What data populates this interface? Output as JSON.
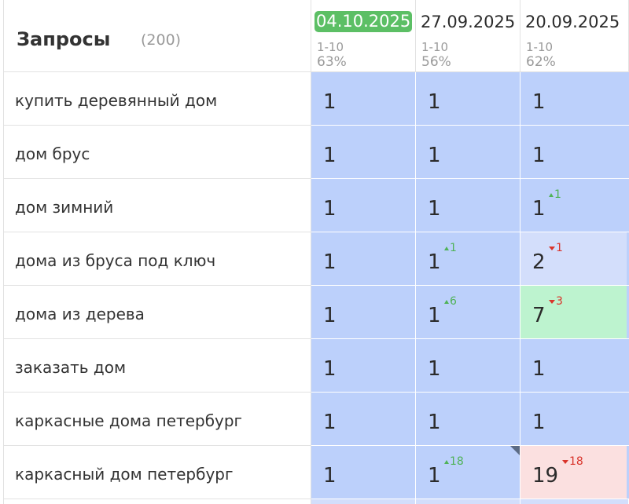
{
  "header": {
    "title": "Запросы",
    "count": "(200)",
    "dates": [
      {
        "date": "04.10.2025",
        "active": true,
        "range": "1-10",
        "pct": "63%"
      },
      {
        "date": "27.09.2025",
        "active": false,
        "range": "1-10",
        "pct": "56%"
      },
      {
        "date": "20.09.2025",
        "active": false,
        "range": "1-10",
        "pct": "62%"
      }
    ]
  },
  "rows": [
    {
      "query": "купить деревянный дом",
      "cells": [
        {
          "value": "1",
          "delta": "",
          "dir": "",
          "style": "blue"
        },
        {
          "value": "1",
          "delta": "",
          "dir": "",
          "style": "blue"
        },
        {
          "value": "1",
          "delta": "",
          "dir": "",
          "style": "blue"
        }
      ]
    },
    {
      "query": "дом брус",
      "cells": [
        {
          "value": "1",
          "delta": "",
          "dir": "",
          "style": "blue"
        },
        {
          "value": "1",
          "delta": "",
          "dir": "",
          "style": "blue"
        },
        {
          "value": "1",
          "delta": "",
          "dir": "",
          "style": "blue"
        }
      ]
    },
    {
      "query": "дом зимний",
      "cells": [
        {
          "value": "1",
          "delta": "",
          "dir": "",
          "style": "blue"
        },
        {
          "value": "1",
          "delta": "",
          "dir": "",
          "style": "blue"
        },
        {
          "value": "1",
          "delta": "1",
          "dir": "up",
          "style": "blue"
        }
      ]
    },
    {
      "query": "дома из бруса под ключ",
      "cells": [
        {
          "value": "1",
          "delta": "",
          "dir": "",
          "style": "blue"
        },
        {
          "value": "1",
          "delta": "1",
          "dir": "up",
          "style": "blue"
        },
        {
          "value": "2",
          "delta": "1",
          "dir": "down",
          "style": "light"
        }
      ]
    },
    {
      "query": "дома из дерева",
      "cells": [
        {
          "value": "1",
          "delta": "",
          "dir": "",
          "style": "blue"
        },
        {
          "value": "1",
          "delta": "6",
          "dir": "up",
          "style": "blue"
        },
        {
          "value": "7",
          "delta": "3",
          "dir": "down",
          "style": "green"
        }
      ]
    },
    {
      "query": "заказать дом",
      "cells": [
        {
          "value": "1",
          "delta": "",
          "dir": "",
          "style": "blue"
        },
        {
          "value": "1",
          "delta": "",
          "dir": "",
          "style": "blue"
        },
        {
          "value": "1",
          "delta": "",
          "dir": "",
          "style": "blue"
        }
      ]
    },
    {
      "query": "каркасные дома петербург",
      "cells": [
        {
          "value": "1",
          "delta": "",
          "dir": "",
          "style": "blue"
        },
        {
          "value": "1",
          "delta": "",
          "dir": "",
          "style": "blue"
        },
        {
          "value": "1",
          "delta": "",
          "dir": "",
          "style": "blue"
        }
      ]
    },
    {
      "query": "каркасный дом петербург",
      "cells": [
        {
          "value": "1",
          "delta": "",
          "dir": "",
          "style": "blue"
        },
        {
          "value": "1",
          "delta": "18",
          "dir": "up",
          "style": "blue",
          "marker": true
        },
        {
          "value": "19",
          "delta": "18",
          "dir": "down",
          "style": "pink"
        }
      ]
    }
  ],
  "colors": {
    "active_date_bg": "#5cbf65",
    "top_position": "#bcd0fb",
    "light_position": "#d3defb",
    "green_position": "#bdf3cf",
    "pink_position": "#fbe0e0",
    "up": "#4fb257",
    "down": "#d9342b"
  }
}
